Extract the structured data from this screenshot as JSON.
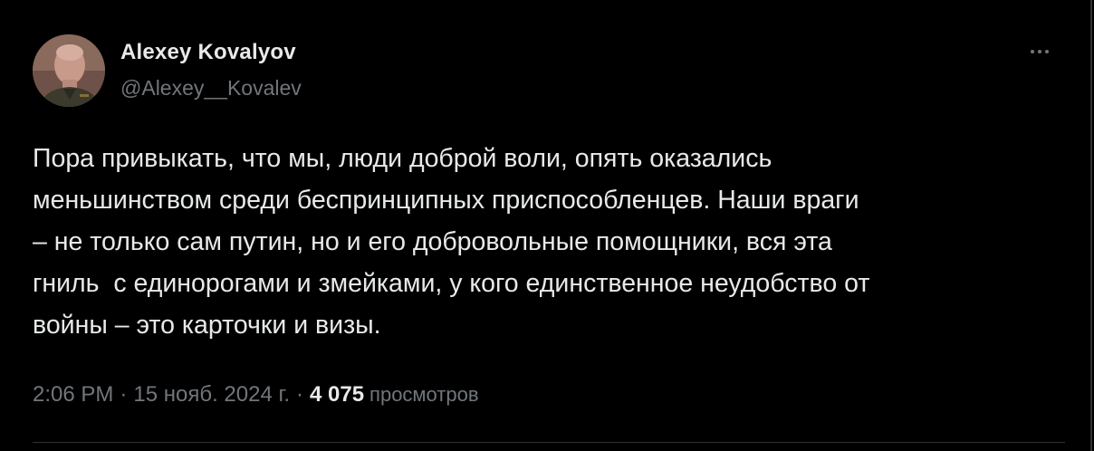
{
  "author": {
    "name": "Alexey Kovalyov",
    "handle": "@Alexey__Kovalev"
  },
  "tweet": {
    "text": "Пора привыкать, что мы, люди доброй воли, опять оказались\nменьшинством среди беспринципных приспособленцев. Наши враги\n– не только сам путин, но и его добровольные помощники, вся эта\nгниль  с единорогами и змейками, у кого единственное неудобство от\nвойны – это карточки и визы."
  },
  "meta": {
    "time": "2:06 PM",
    "separator": "·",
    "date": "15 нояб. 2024 г.",
    "views_count": "4 075",
    "views_label": "просмотров"
  },
  "icons": {
    "more": "more-options-icon"
  },
  "colors": {
    "background": "#000000",
    "primary_text": "#e7e9ea",
    "secondary_text": "#71767b",
    "divider": "#2f3336"
  }
}
